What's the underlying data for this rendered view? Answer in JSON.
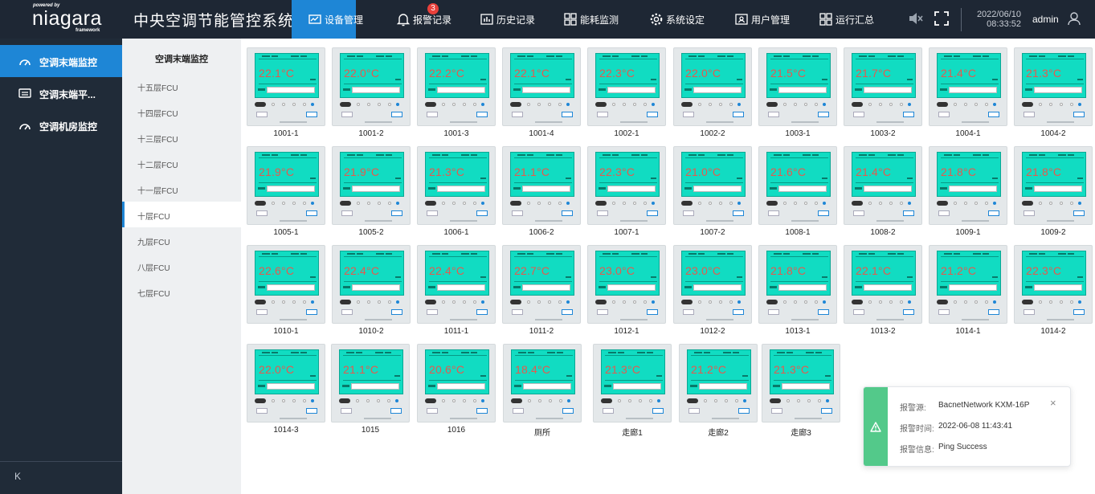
{
  "logo": {
    "powered": "powered by",
    "brand": "niagara",
    "framework": "framework"
  },
  "app_title": "中央空调节能管控系统",
  "nav": [
    {
      "label": "设备管理",
      "icon": "monitor-chart-icon",
      "active": true
    },
    {
      "label": "报警记录",
      "icon": "bell-icon",
      "badge": "3"
    },
    {
      "label": "历史记录",
      "icon": "bar-chart-icon"
    },
    {
      "label": "能耗监测",
      "icon": "grid-icon"
    },
    {
      "label": "系统设定",
      "icon": "gear-icon"
    },
    {
      "label": "用户管理",
      "icon": "user-card-icon"
    },
    {
      "label": "运行汇总",
      "icon": "grid-icon"
    }
  ],
  "clock": {
    "date": "2022/06/10",
    "time": "08:33:52"
  },
  "user": {
    "name": "admin"
  },
  "sidebar": {
    "items": [
      {
        "label": "空调末端监控",
        "icon": "gauge-icon",
        "active": true
      },
      {
        "label": "空调末端平...",
        "icon": "keyboard-icon"
      },
      {
        "label": "空调机房监控",
        "icon": "gauge-icon"
      }
    ],
    "collapse_label": "K"
  },
  "floors": {
    "title": "空调末端监控",
    "items": [
      "十五层FCU",
      "十四层FCU",
      "十三层FCU",
      "十二层FCU",
      "十一层FCU",
      "十层FCU",
      "九层FCU",
      "八层FCU",
      "七层FCU"
    ],
    "active_index": 5
  },
  "devices": [
    {
      "name": "1001-1",
      "temp": "22.1°C"
    },
    {
      "name": "1001-2",
      "temp": "22.0°C"
    },
    {
      "name": "1001-3",
      "temp": "22.2°C"
    },
    {
      "name": "1001-4",
      "temp": "22.1°C"
    },
    {
      "name": "1002-1",
      "temp": "22.3°C"
    },
    {
      "name": "1002-2",
      "temp": "22.0°C"
    },
    {
      "name": "1003-1",
      "temp": "21.5°C"
    },
    {
      "name": "1003-2",
      "temp": "21.7°C"
    },
    {
      "name": "1004-1",
      "temp": "21.4°C"
    },
    {
      "name": "1004-2",
      "temp": "21.3°C"
    },
    {
      "name": "1005-1",
      "temp": "21.9°C"
    },
    {
      "name": "1005-2",
      "temp": "21.9°C"
    },
    {
      "name": "1006-1",
      "temp": "21.3°C"
    },
    {
      "name": "1006-2",
      "temp": "21.1°C"
    },
    {
      "name": "1007-1",
      "temp": "22.3°C"
    },
    {
      "name": "1007-2",
      "temp": "21.0°C"
    },
    {
      "name": "1008-1",
      "temp": "21.6°C"
    },
    {
      "name": "1008-2",
      "temp": "21.4°C"
    },
    {
      "name": "1009-1",
      "temp": "21.8°C"
    },
    {
      "name": "1009-2",
      "temp": "21.8°C"
    },
    {
      "name": "1010-1",
      "temp": "22.6°C"
    },
    {
      "name": "1010-2",
      "temp": "22.4°C"
    },
    {
      "name": "1011-1",
      "temp": "22.4°C"
    },
    {
      "name": "1011-2",
      "temp": "22.7°C"
    },
    {
      "name": "1012-1",
      "temp": "23.0°C"
    },
    {
      "name": "1012-2",
      "temp": "23.0°C"
    },
    {
      "name": "1013-1",
      "temp": "21.8°C"
    },
    {
      "name": "1013-2",
      "temp": "22.1°C"
    },
    {
      "name": "1014-1",
      "temp": "21.2°C"
    },
    {
      "name": "1014-2",
      "temp": "22.3°C"
    },
    {
      "name": "1014-3",
      "temp": "22.0°C"
    },
    {
      "name": "1015",
      "temp": "21.1°C"
    },
    {
      "name": "1016",
      "temp": "20.6°C"
    },
    {
      "name": "厕所",
      "temp": "18.4°C"
    },
    {
      "name": "走廊1",
      "temp": "21.3°C"
    },
    {
      "name": "走廊2",
      "temp": "21.2°C"
    },
    {
      "name": "走廊3",
      "temp": "21.3°C"
    }
  ],
  "alarm": {
    "source_label": "报警源:",
    "source": "BacnetNetwork KXM-16P",
    "time_label": "报警时间:",
    "time": "2022-06-08 11:43:41",
    "info_label": "报警信息:",
    "info": "Ping Success",
    "close": "×"
  },
  "colors": {
    "topbar": "#1e2734",
    "accent": "#1e86d6",
    "lcd": "#11dcc2",
    "temp_text": "#e45a4e",
    "toast_accent": "#53c98a"
  }
}
